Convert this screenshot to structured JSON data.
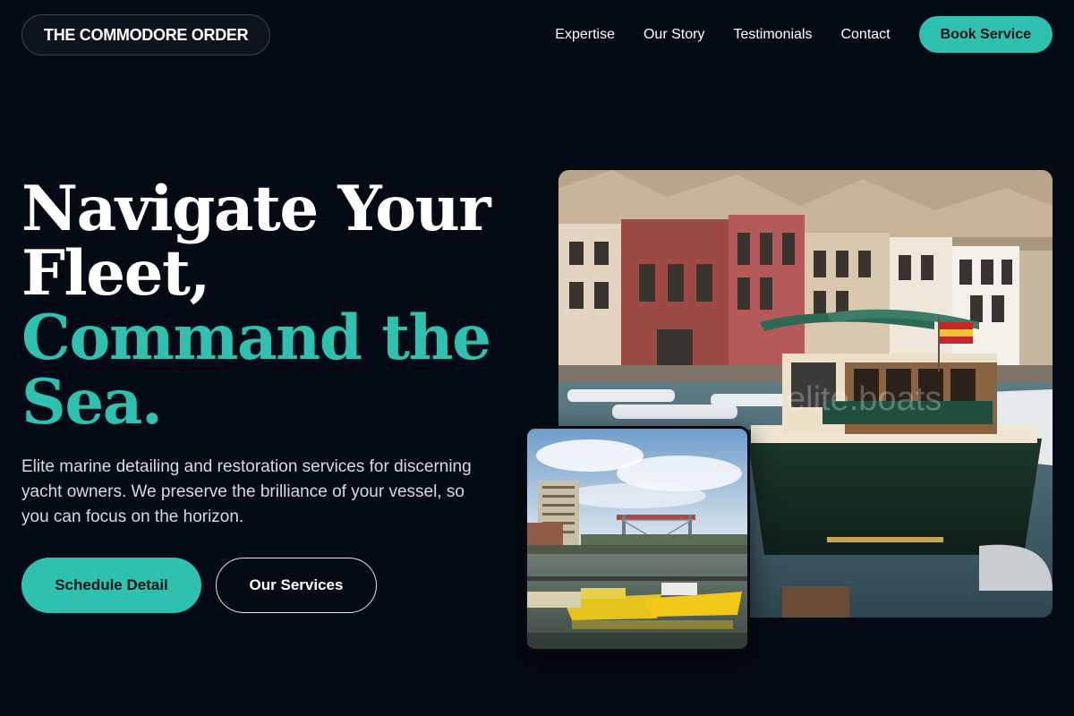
{
  "brand": {
    "name": "THE COMMODORE ORDER"
  },
  "nav": {
    "links": [
      "Expertise",
      "Our Story",
      "Testimonials",
      "Contact"
    ],
    "cta": "Book Service"
  },
  "hero": {
    "headline_lines": [
      "Navigate Your",
      "Fleet,"
    ],
    "headline_accent_lines": [
      "Command the",
      "Sea."
    ],
    "lead": "Elite marine detailing and restoration services for discerning yacht owners. We preserve the brilliance of your vessel, so you can focus on the horizon.",
    "primary_button": "Schedule Detail",
    "secondary_button": "Our Services"
  },
  "colors": {
    "background": "#050b14",
    "accent": "#2fc1b0",
    "text": "#ffffff"
  },
  "images": {
    "main": {
      "watermark": "elite.boats"
    },
    "secondary": {}
  }
}
